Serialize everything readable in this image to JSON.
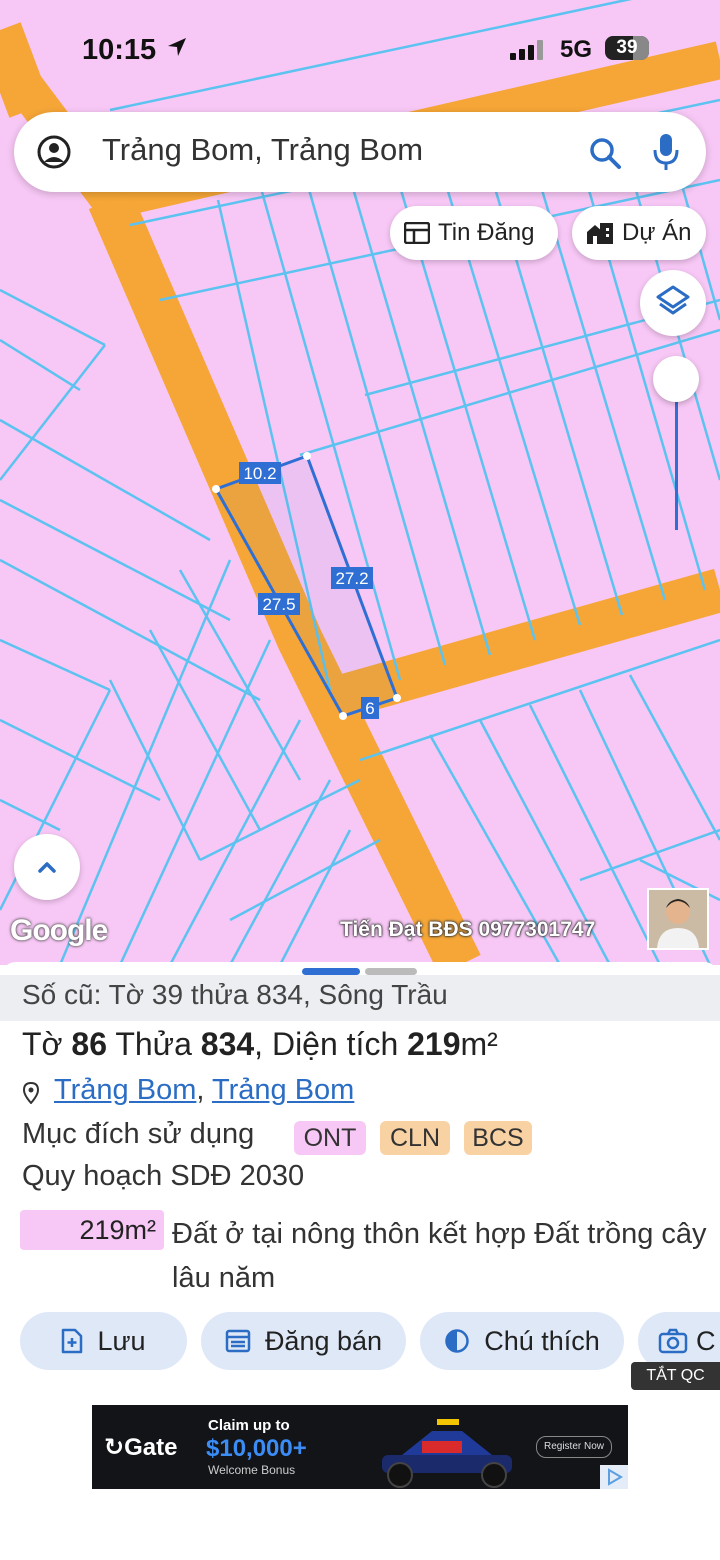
{
  "status_bar": {
    "time": "10:15",
    "network": "5G",
    "battery": "39"
  },
  "search": {
    "query": "Trảng Bom, Trảng Bom"
  },
  "map_chips": {
    "listings": "Tin Đăng",
    "projects": "Dự Án"
  },
  "map": {
    "edge_labels": [
      "10.2",
      "27.2",
      "27.5",
      "6"
    ],
    "google_label": "Google",
    "watermark": "Tiến Đạt BĐS 0977301747",
    "colors": {
      "land": "#f7c7f5",
      "road": "#f5a637",
      "parcel_line": "#5cc3f0",
      "selection": "#2f6fd4"
    }
  },
  "sheet": {
    "old_ref": "Số cũ: Tờ 39 thửa 834, Sông Trầu",
    "title": {
      "sheet_label": "Tờ",
      "sheet_no": "86",
      "plot_label": "Thửa",
      "plot_no": "834",
      "area_label": ", Diện tích",
      "area_value": "219",
      "area_unit": "m²"
    },
    "location": {
      "district": "Trảng Bom",
      "separator": ", ",
      "town": "Trảng Bom"
    },
    "purpose": {
      "label": "Mục đích sử dụng",
      "tags": [
        "ONT",
        "CLN",
        "BCS"
      ]
    },
    "plan_label": "Quy hoạch SDĐ 2030",
    "plan_area": "219m²",
    "plan_desc": "Đất ở tại nông thôn kết hợp Đất trồng cây lâu năm",
    "actions": [
      "Lưu",
      "Đăng bán",
      "Chú thích",
      "C"
    ],
    "ad_toggle": "TẮT QC"
  },
  "ad": {
    "brand": "Gate",
    "claim": "Claim up to",
    "amount": "$10,000+",
    "bonus": "Welcome Bonus",
    "cta": "Register Now"
  }
}
